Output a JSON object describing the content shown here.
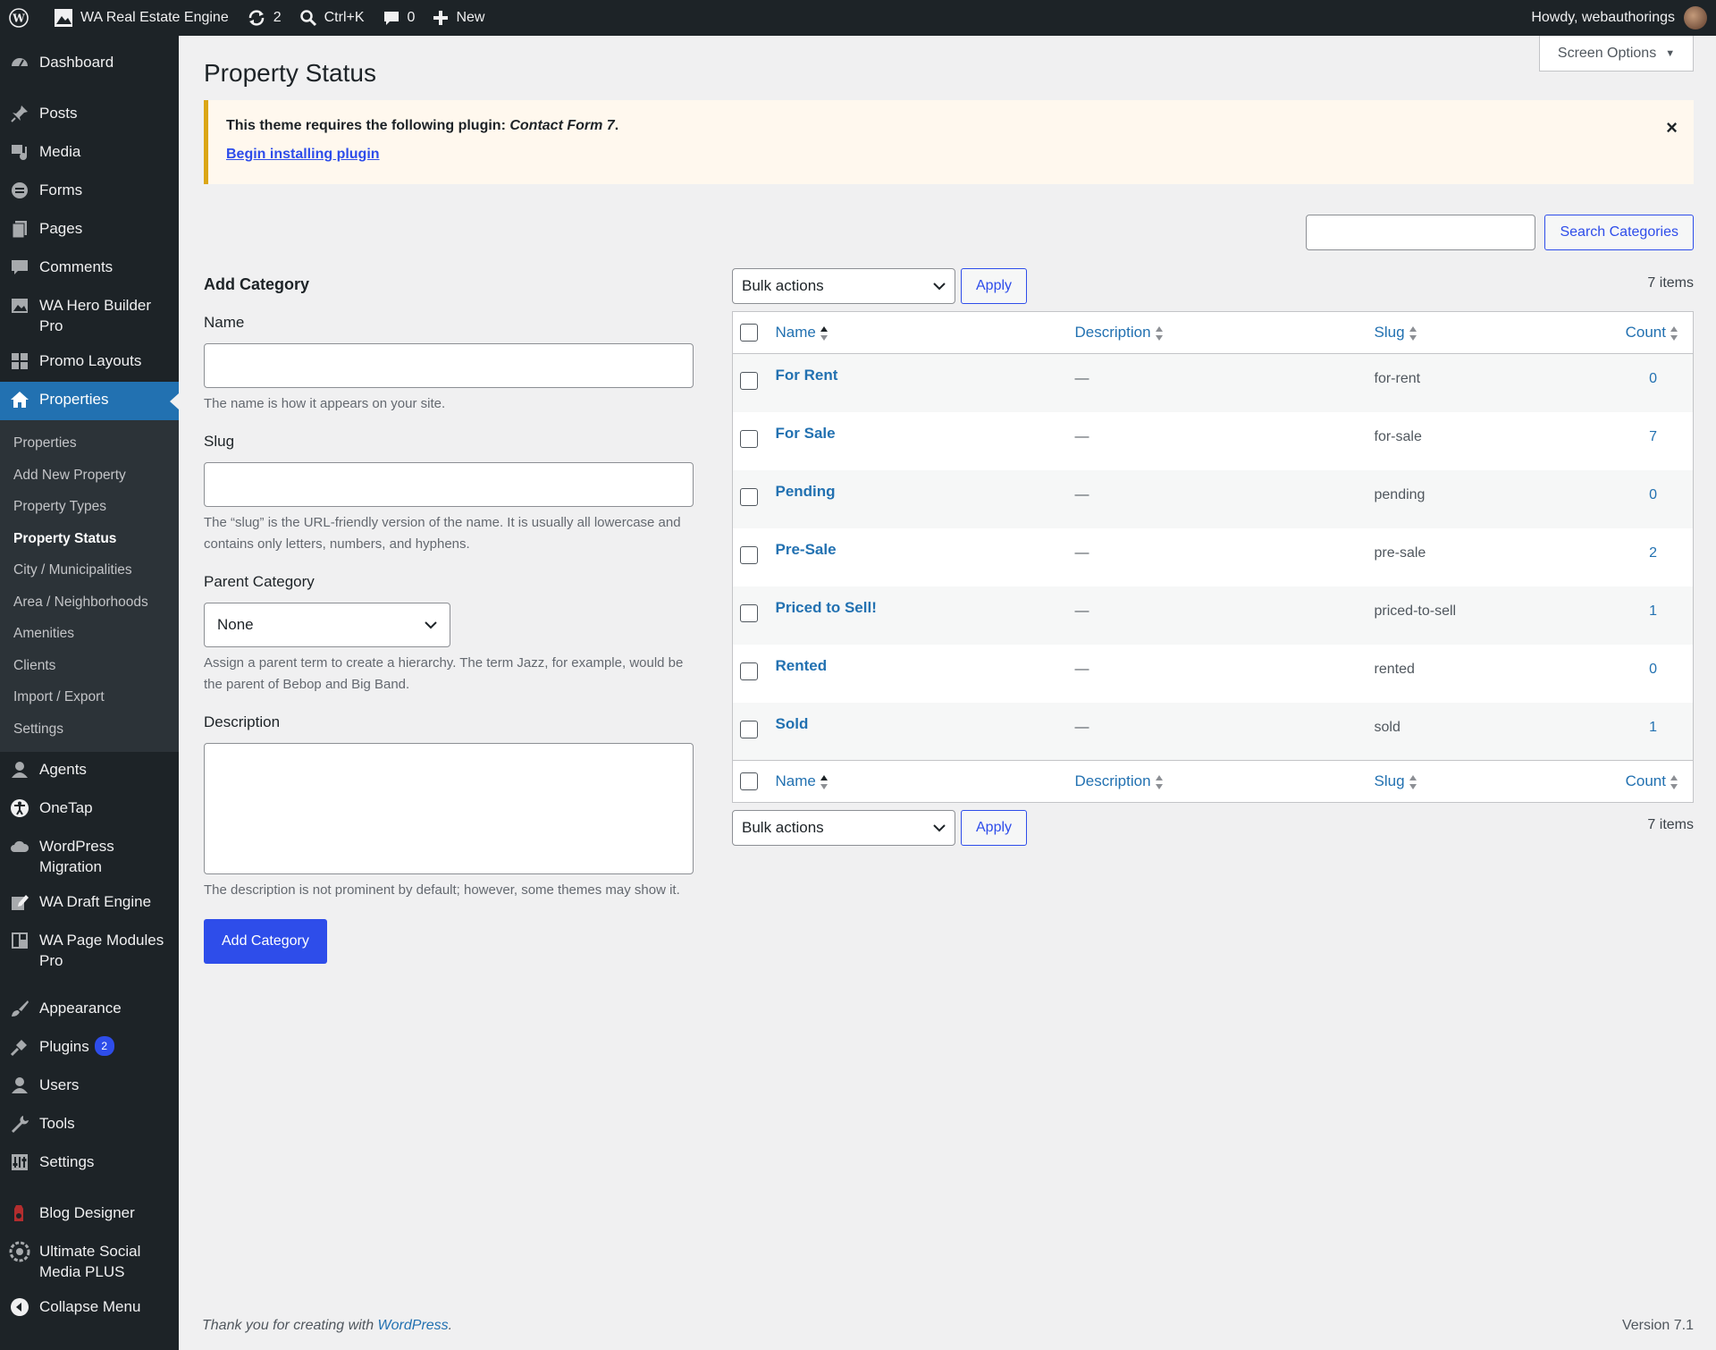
{
  "adminbar": {
    "site_name": "WA Real Estate Engine",
    "updates_count": "2",
    "search_shortcut": "Ctrl+K",
    "comments_count": "0",
    "new_label": "New",
    "greeting": "Howdy, webauthorings"
  },
  "sidebar": {
    "items_top": [
      {
        "label": "Dashboard",
        "icon": "dashboard-icon"
      }
    ],
    "items_a": [
      {
        "label": "Posts",
        "icon": "pin-icon"
      },
      {
        "label": "Media",
        "icon": "media-icon"
      },
      {
        "label": "Forms",
        "icon": "forms-icon"
      },
      {
        "label": "Pages",
        "icon": "pages-icon"
      },
      {
        "label": "Comments",
        "icon": "comment-icon"
      },
      {
        "label": "WA Hero Builder Pro",
        "icon": "image-icon"
      },
      {
        "label": "Promo Layouts",
        "icon": "grid-icon"
      },
      {
        "label": "Properties",
        "icon": "home-icon"
      }
    ],
    "submenu": [
      "Properties",
      "Add New Property",
      "Property Types",
      "Property Status",
      "City / Municipalities",
      "Area / Neighborhoods",
      "Amenities",
      "Clients",
      "Import / Export",
      "Settings"
    ],
    "items_b": [
      {
        "label": "Agents",
        "icon": "user-icon"
      },
      {
        "label": "OneTap",
        "icon": "accessibility-icon"
      },
      {
        "label": "WordPress Migration",
        "icon": "cloud-icon"
      },
      {
        "label": "WA Draft Engine",
        "icon": "edit-icon"
      },
      {
        "label": "WA Page Modules Pro",
        "icon": "modules-icon"
      }
    ],
    "items_c": [
      {
        "label": "Appearance",
        "icon": "brush-icon"
      },
      {
        "label": "Plugins",
        "icon": "plug-icon",
        "badge": "2"
      },
      {
        "label": "Users",
        "icon": "users-icon"
      },
      {
        "label": "Tools",
        "icon": "wrench-icon"
      },
      {
        "label": "Settings",
        "icon": "settings-icon"
      }
    ],
    "items_d": [
      {
        "label": "Blog Designer",
        "icon": "blog-designer-icon"
      },
      {
        "label": "Ultimate Social Media PLUS",
        "icon": "social-icon"
      },
      {
        "label": "Collapse Menu",
        "icon": "collapse-icon"
      }
    ]
  },
  "page": {
    "title": "Property Status",
    "screen_options": "Screen Options"
  },
  "notice": {
    "text_prefix": "This theme requires the following plugin: ",
    "plugin": "Contact Form 7",
    "text_suffix": ".",
    "link": "Begin installing plugin",
    "dismiss": "×"
  },
  "search": {
    "button": "Search Categories"
  },
  "form": {
    "heading": "Add Category",
    "name_label": "Name",
    "name_help": "The name is how it appears on your site.",
    "slug_label": "Slug",
    "slug_help": "The “slug” is the URL-friendly version of the name. It is usually all lowercase and contains only letters, numbers, and hyphens.",
    "parent_label": "Parent Category",
    "parent_value": "None",
    "parent_help": "Assign a parent term to create a hierarchy. The term Jazz, for example, would be the parent of Bebop and Big Band.",
    "description_label": "Description",
    "description_help": "The description is not prominent by default; however, some themes may show it.",
    "submit": "Add Category"
  },
  "table": {
    "bulk_actions": "Bulk actions",
    "apply": "Apply",
    "items_count": "7 items",
    "columns": {
      "name": "Name",
      "description": "Description",
      "slug": "Slug",
      "count": "Count"
    },
    "rows": [
      {
        "name": "For Rent",
        "description": "—",
        "slug": "for-rent",
        "count": "0"
      },
      {
        "name": "For Sale",
        "description": "—",
        "slug": "for-sale",
        "count": "7"
      },
      {
        "name": "Pending",
        "description": "—",
        "slug": "pending",
        "count": "0"
      },
      {
        "name": "Pre-Sale",
        "description": "—",
        "slug": "pre-sale",
        "count": "2"
      },
      {
        "name": "Priced to Sell!",
        "description": "—",
        "slug": "priced-to-sell",
        "count": "1"
      },
      {
        "name": "Rented",
        "description": "—",
        "slug": "rented",
        "count": "0"
      },
      {
        "name": "Sold",
        "description": "—",
        "slug": "sold",
        "count": "1"
      }
    ]
  },
  "footer": {
    "thanks_prefix": "Thank you for creating with ",
    "thanks_link": "WordPress",
    "thanks_suffix": ".",
    "version": "Version 7.1"
  },
  "colors": {
    "accent": "#2e4dea",
    "link": "#2271b1",
    "sidebar_bg": "#1d2327",
    "current_menu": "#2271b1",
    "notice_border": "#dba617"
  }
}
